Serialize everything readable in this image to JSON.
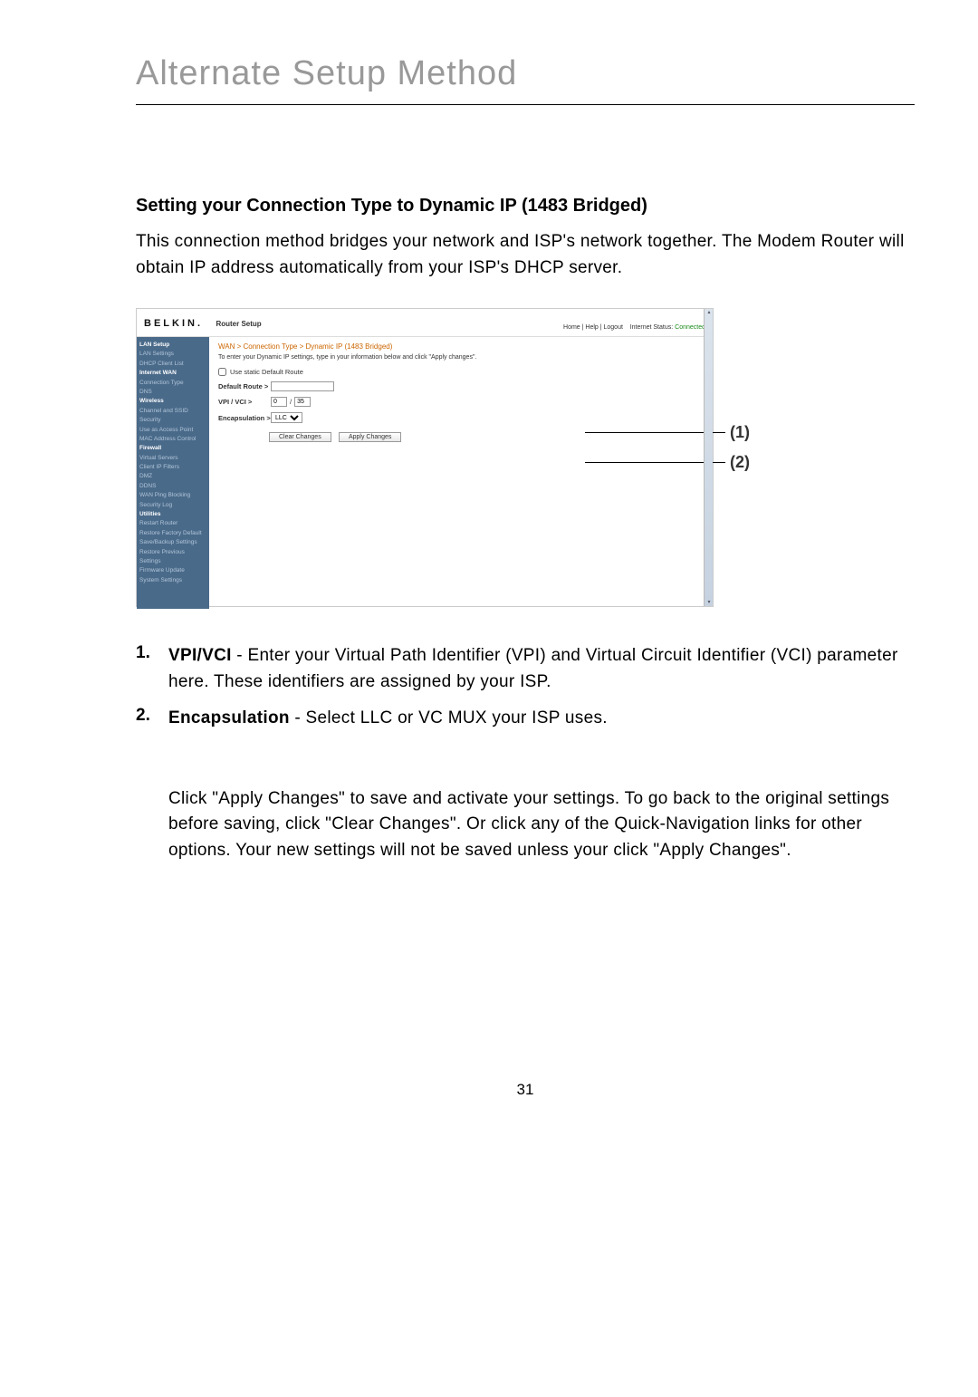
{
  "page": {
    "title": "Alternate Setup Method",
    "heading": "Setting your Connection Type to Dynamic IP (1483 Bridged)",
    "intro": "This connection method bridges your network and ISP's network together. The Modem Router will obtain IP address automatically from your ISP's DHCP server.",
    "page_number": "31"
  },
  "screenshot": {
    "brand": "BELKIN.",
    "subtitle": "Router Setup",
    "toplinks_left": "Home | Help | Logout",
    "toplinks_right_label": "Internet Status:",
    "toplinks_right_status": "Connected",
    "breadcrumb": "WAN > Connection Type > Dynamic IP (1483 Bridged)",
    "instruction": "To enter your Dynamic IP settings, type in your information below and click \"Apply changes\".",
    "checkbox_label": "Use static Default Route",
    "default_route_label": "Default Route >",
    "vpi_vci_label": "VPI / VCI >",
    "vpi_value": "0",
    "vci_value": "35",
    "encap_label": "Encapsulation >",
    "encap_value": "LLC",
    "clear_btn": "Clear Changes",
    "apply_btn": "Apply Changes",
    "sidebar": {
      "g1h": "LAN Setup",
      "g1a": "LAN Settings",
      "g1b": "DHCP Client List",
      "g2h": "Internet WAN",
      "g2a": "Connection Type",
      "g2b": "DNS",
      "g3h": "Wireless",
      "g3a": "Channel and SSID",
      "g3b": "Security",
      "g3c": "Use as Access Point",
      "g3d": "MAC Address Control",
      "g4h": "Firewall",
      "g4a": "Virtual Servers",
      "g4b": "Client IP Filters",
      "g4c": "DMZ",
      "g4d": "DDNS",
      "g4e": "WAN Ping Blocking",
      "g4f": "Security Log",
      "g5h": "Utilities",
      "g5a": "Restart Router",
      "g5b": "Restore Factory Default",
      "g5c": "Save/Backup Settings",
      "g5d": "Restore Previous Settings",
      "g5e": "Firmware Update",
      "g5f": "System Settings"
    },
    "callout1": "(1)",
    "callout2": "(2)"
  },
  "list": {
    "n1": "1.",
    "n1_bold": "VPI/VCI",
    "n1_text": " - Enter your Virtual Path Identifier (VPI) and Virtual Circuit Identifier (VCI) parameter here. These identifiers are assigned by your ISP.",
    "n2": "2.",
    "n2_bold": "Encapsulation",
    "n2_text": " - Select LLC or VC MUX your ISP uses."
  },
  "closing": "Click \"Apply Changes\" to save and activate your settings. To go back to the original settings before saving, click \"Clear Changes\". Or click any of the Quick-Navigation links for other options. Your new settings will not be saved unless your click \"Apply Changes\"."
}
